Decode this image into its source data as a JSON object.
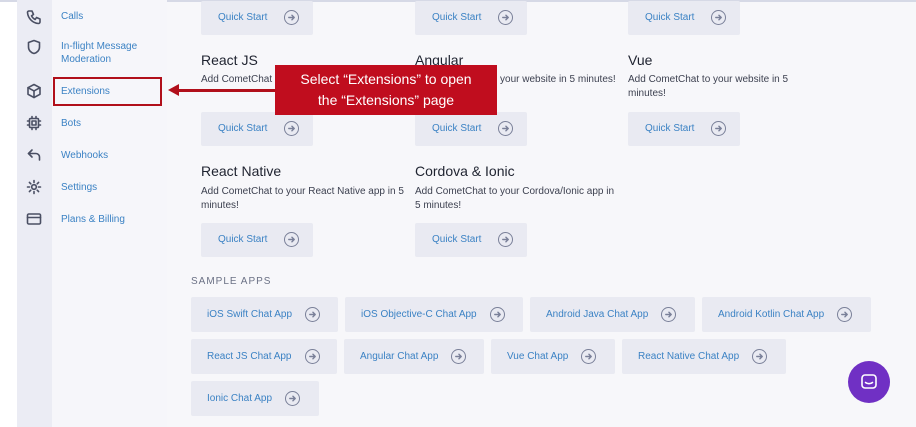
{
  "sidebar": {
    "items": [
      {
        "label": "Calls",
        "icon": "phone-icon"
      },
      {
        "label": "In-flight Message Moderation",
        "icon": "shield-icon"
      },
      {
        "label": "Extensions",
        "icon": "cube-icon"
      },
      {
        "label": "Bots",
        "icon": "chip-icon"
      },
      {
        "label": "Webhooks",
        "icon": "return-arrow-icon"
      },
      {
        "label": "Settings",
        "icon": "gear-icon"
      },
      {
        "label": "Plans & Billing",
        "icon": "credit-card-icon"
      }
    ],
    "highlighted": "Extensions"
  },
  "quickstart_label": "Quick Start",
  "frameworks": [
    {
      "title": "",
      "description": ""
    },
    {
      "title": "",
      "description": ""
    },
    {
      "title": "",
      "description": ""
    },
    {
      "title": "React JS",
      "description": "Add CometChat to your website in 5 minutes!"
    },
    {
      "title": "Angular",
      "description": "Add CometChat to your website in 5 minutes!"
    },
    {
      "title": "Vue",
      "description": "Add CometChat to your website in 5 minutes!"
    },
    {
      "title": "React Native",
      "description": "Add CometChat to your React Native app in 5 minutes!"
    },
    {
      "title": "Cordova & Ionic",
      "description": "Add CometChat to your Cordova/Ionic app in 5 minutes!"
    }
  ],
  "sample_apps": {
    "heading": "SAMPLE APPS",
    "items": [
      "iOS Swift Chat App",
      "iOS Objective-C Chat App",
      "Android Java Chat App",
      "Android Kotlin Chat App",
      "React JS Chat App",
      "Angular Chat App",
      "Vue Chat App",
      "React Native Chat App",
      "Ionic Chat App"
    ]
  },
  "callout": {
    "line1": "Select “Extensions” to open",
    "line2": "the “Extensions” page"
  },
  "colors": {
    "accent_link": "#3b82c4",
    "callout_red": "#c00d1e",
    "chat_purple": "#7030c4"
  }
}
